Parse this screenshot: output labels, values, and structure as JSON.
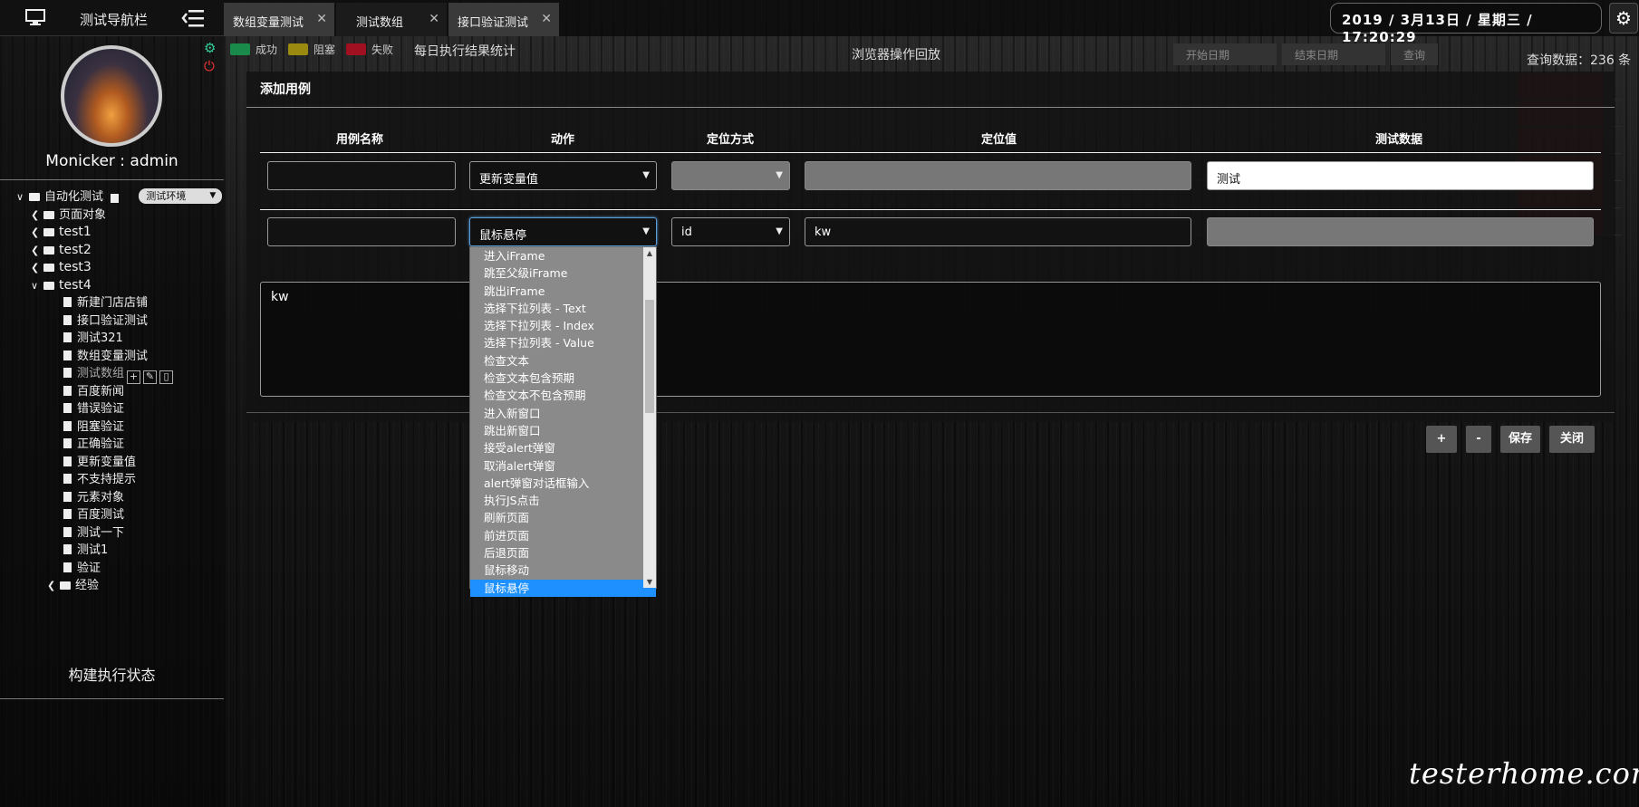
{
  "header": {
    "nav_title": "测试导航栏",
    "tabs": [
      {
        "label": "数组变量测试"
      },
      {
        "label": "测试数组"
      },
      {
        "label": "接口验证测试"
      }
    ],
    "datetime": "2019 / 3月13日 / 星期三 / 17:20:29"
  },
  "sidebar": {
    "user_label": "Monicker : admin",
    "tree": {
      "root": "自动化测试",
      "env": "测试环境",
      "page_objects": "页面对象",
      "groups": [
        "test1",
        "test2",
        "test3",
        "test4"
      ],
      "test4_items": [
        "新建门店店铺",
        "接口验证测试",
        "测试321",
        "数组变量测试",
        "测试数组",
        "百度新闻",
        "错误验证",
        "阻塞验证",
        "正确验证",
        "更新变量值",
        "不支持提示",
        "元素对象",
        "百度测试",
        "测试一下",
        "测试1",
        "验证"
      ],
      "experience": "经验"
    },
    "build_status": "构建执行状态"
  },
  "legend": {
    "success": "成功",
    "blocked": "阻塞",
    "failed": "失败",
    "colors": {
      "success": "#1a8a4a",
      "blocked": "#9a8a10",
      "failed": "#a01020"
    }
  },
  "stats_title": "每日执行结果统计",
  "replay_title": "浏览器操作回放",
  "filters": {
    "start_date": "开始日期",
    "end_date": "结束日期",
    "query": "查询"
  },
  "query_count": "查询数据：236 条",
  "modal": {
    "title": "添加用例",
    "columns": {
      "name": "用例名称",
      "action": "动作",
      "locator_type": "定位方式",
      "locator_value": "定位值",
      "test_data": "测试数据"
    },
    "row1": {
      "action": "更新变量值",
      "test_data": "测试"
    },
    "row2": {
      "action": "鼠标悬停",
      "locator_type": "id",
      "locator_value": "kw"
    },
    "textarea": "kw",
    "buttons": {
      "add": "+",
      "remove": "-",
      "save": "保存",
      "close": "关闭"
    }
  },
  "dropdown": {
    "options": [
      "进入iFrame",
      "跳至父级iFrame",
      "跳出iFrame",
      "选择下拉列表 - Text",
      "选择下拉列表 - Index",
      "选择下拉列表 - Value",
      "检查文本",
      "检查文本包含预期",
      "检查文本不包含预期",
      "进入新窗口",
      "跳出新窗口",
      "接受alert弹窗",
      "取消alert弹窗",
      "alert弹窗对话框输入",
      "执行JS点击",
      "刷新页面",
      "前进页面",
      "后退页面",
      "鼠标移动",
      "鼠标悬停"
    ],
    "selected_index": 19
  },
  "watermark": "testerhome.com"
}
